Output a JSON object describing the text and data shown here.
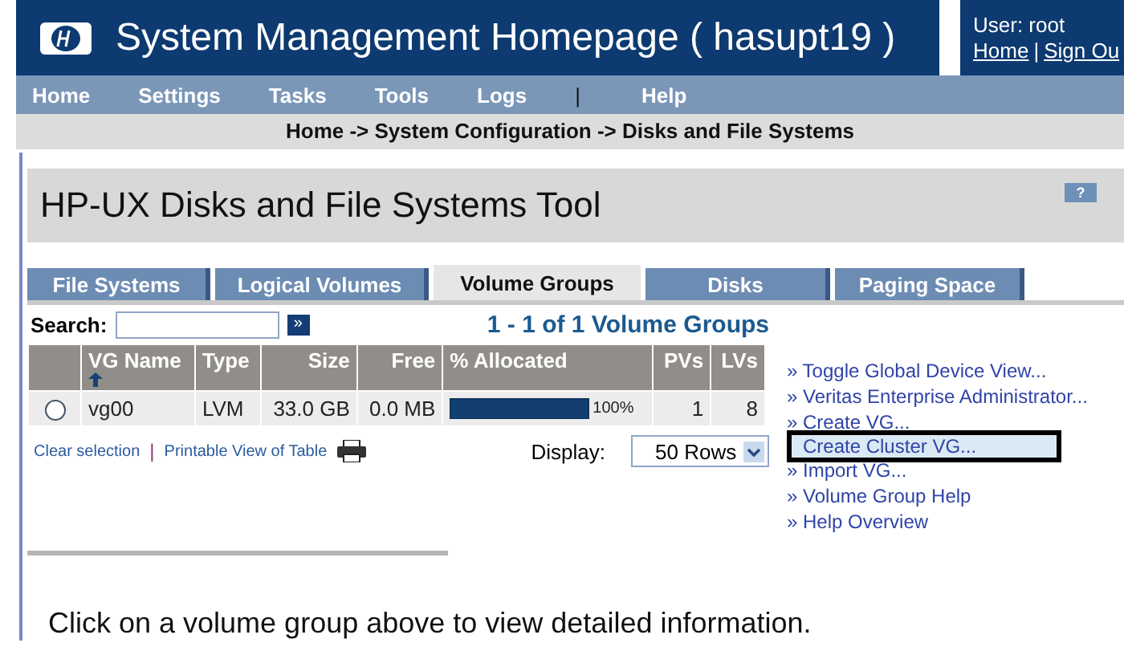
{
  "header": {
    "title": "System Management Homepage ( hasupt19 )",
    "user": "User: root",
    "links": [
      "Home",
      "Sign Ou"
    ],
    "separator": "|"
  },
  "nav": [
    {
      "label": "Home"
    },
    {
      "label": "Settings"
    },
    {
      "label": "Tasks"
    },
    {
      "label": "Tools"
    },
    {
      "label": "Logs"
    },
    {
      "label": "|",
      "kind": "separator"
    },
    {
      "label": "Help"
    }
  ],
  "breadcrumb": "Home -> System Configuration -> Disks and File Systems",
  "tool_title": "HP-UX Disks and File Systems Tool",
  "help_button": "?",
  "tabs": [
    {
      "label": "File Systems",
      "selected": false
    },
    {
      "label": "Logical Volumes",
      "selected": false
    },
    {
      "label": "Volume Groups",
      "selected": true
    },
    {
      "label": "Disks",
      "selected": false
    },
    {
      "label": "Paging Space",
      "selected": false
    }
  ],
  "search": {
    "label": "Search:",
    "go": "»"
  },
  "count": "1 - 1 of 1 Volume Groups",
  "table": {
    "columns": [
      "VG Name",
      "Type",
      "Size",
      "Free",
      "% Allocated",
      "PVs",
      "LVs"
    ],
    "rows": [
      {
        "selected": false,
        "name": "vg00",
        "type": "LVM",
        "size": "33.0 GB",
        "free": "0.0 MB",
        "level": 1.0,
        "allocated": "100%",
        "pvs": "1",
        "lvs": "8"
      }
    ]
  },
  "table_links": [
    "Clear selection",
    "Printable View of Table"
  ],
  "table_links_separator": "|",
  "display": {
    "label": "Display:",
    "value": "50 Rows"
  },
  "actions": [
    {
      "text": "» Toggle Global Device View...",
      "selected": false
    },
    {
      "text": "» Veritas Enterprise Administrator...",
      "selected": false
    },
    {
      "text": "» Create VG...",
      "selected": false
    },
    {
      "text": "Create Cluster VG...",
      "selected": true
    },
    {
      "text": "» Import VG...",
      "selected": false
    },
    {
      "text": "» Volume Group Help",
      "selected": false
    },
    {
      "text": "» Help Overview",
      "selected": false
    }
  ],
  "footer": "Click on a volume group above to view detailed information."
}
